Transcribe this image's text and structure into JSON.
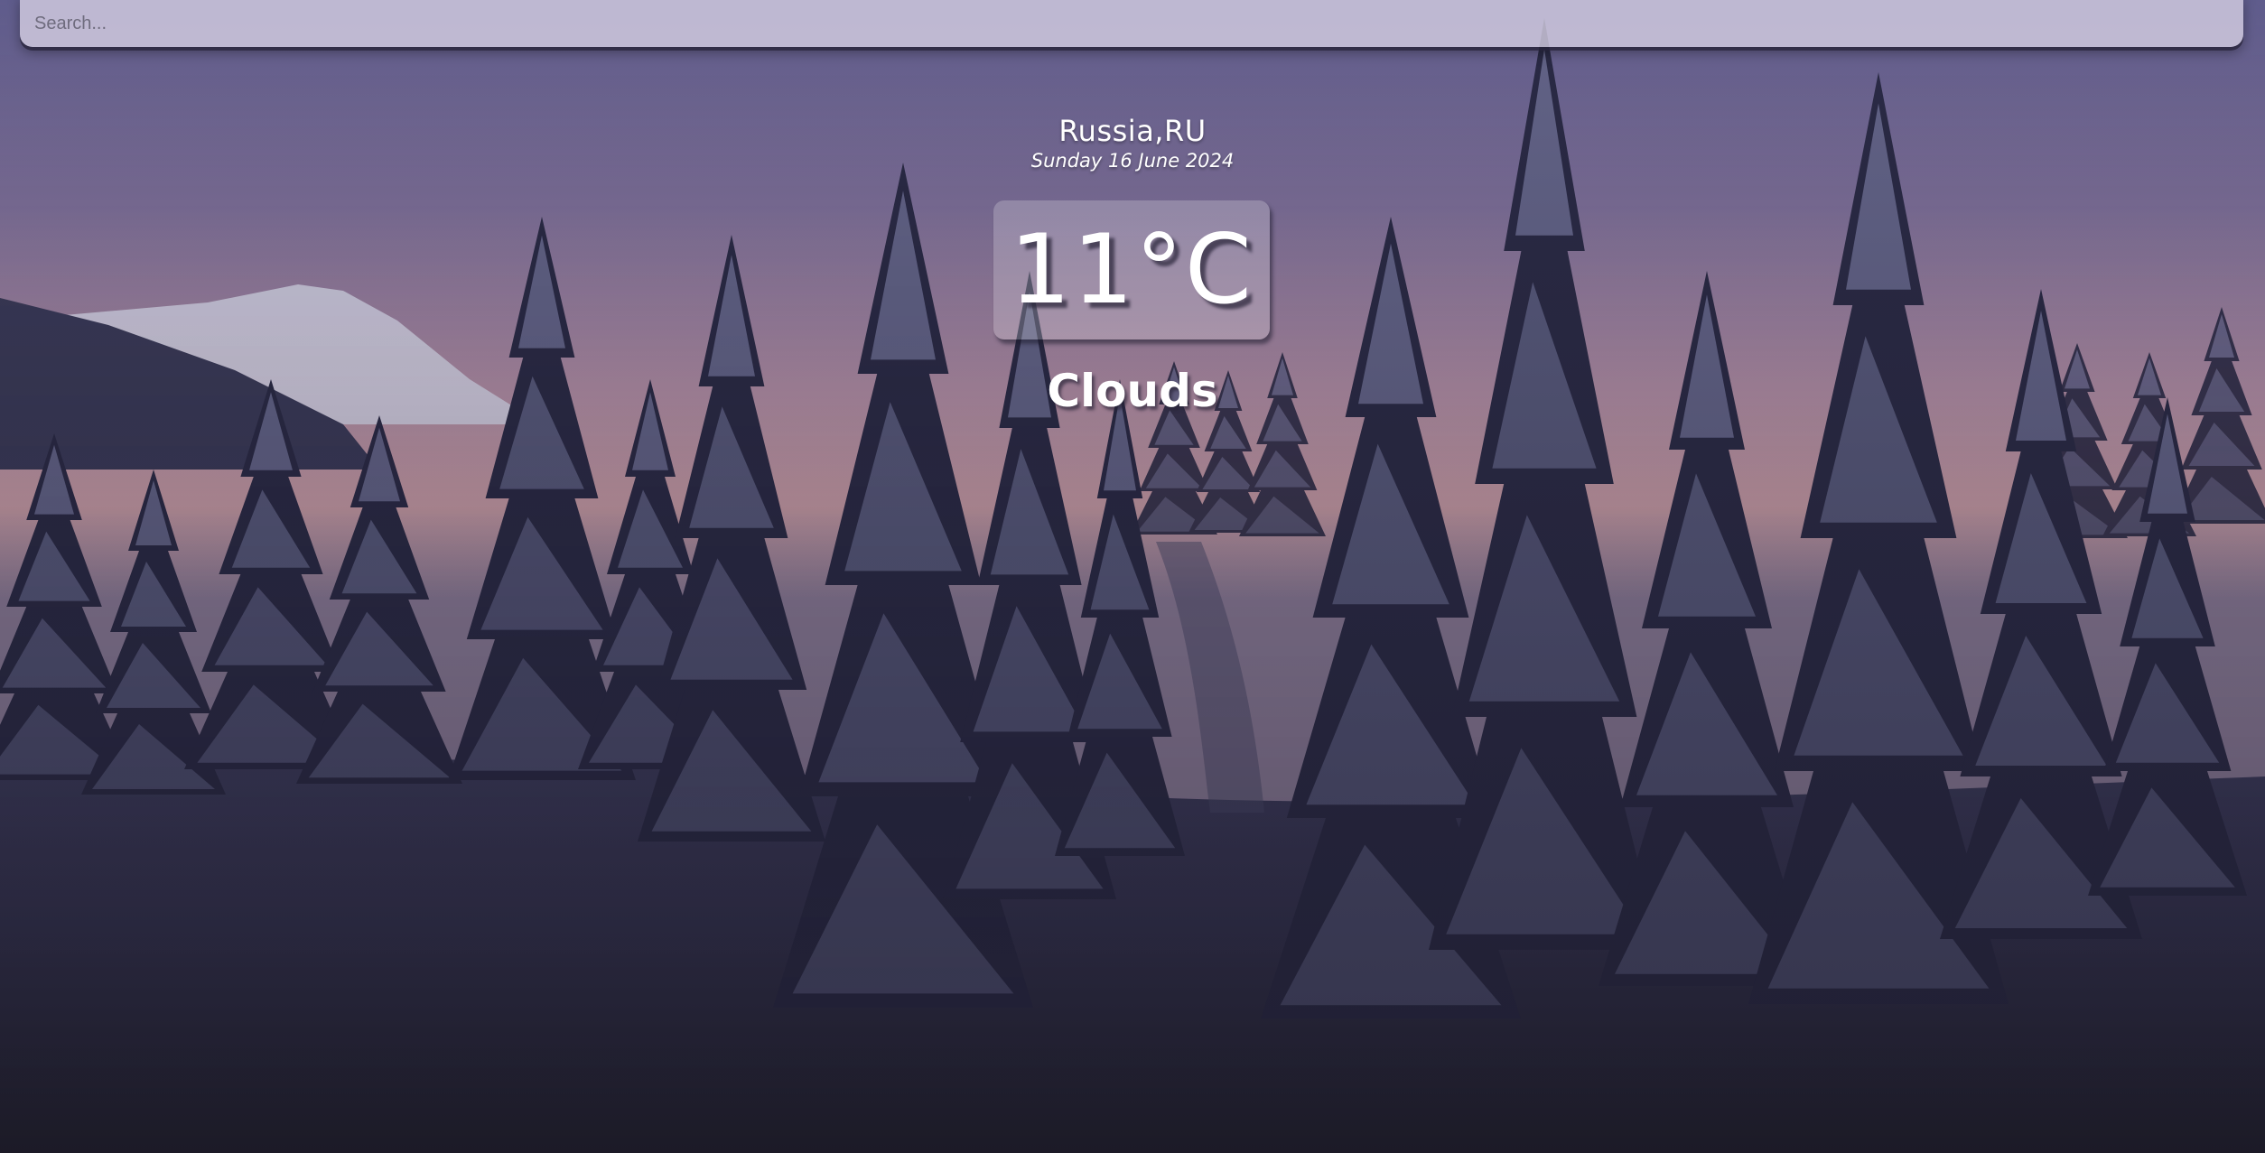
{
  "search": {
    "placeholder": "Search..."
  },
  "weather": {
    "location": "Russia,RU",
    "date": "Sunday 16 June 2024",
    "temperature": "11°C",
    "condition": "Clouds"
  },
  "background": {
    "scene": "snowy-pine-forest-at-dusk",
    "sky_top_color": "#6d6894",
    "sky_horizon_color": "#c79aa4",
    "snow_color": "#2f2e45"
  }
}
